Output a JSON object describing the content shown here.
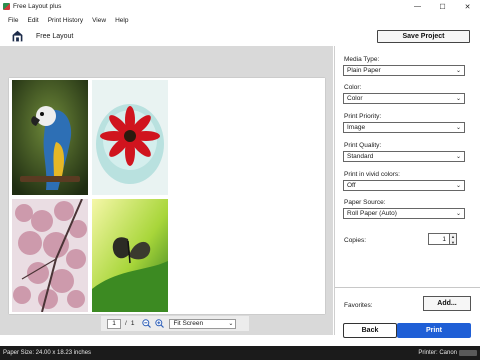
{
  "window": {
    "title": "Free Layout plus",
    "controls": {
      "minimize": "—",
      "maximize": "☐",
      "close": "✕"
    }
  },
  "menu": [
    "File",
    "Edit",
    "Print History",
    "View",
    "Help"
  ],
  "toolbar": {
    "page_label": "Free Layout",
    "save_project_label": "Save Project",
    "home_icon": "home-icon"
  },
  "preview": {
    "photos": [
      "parrot-photo",
      "gerbera-flower-photo",
      "cherry-blossom-photo",
      "butterfly-photo"
    ]
  },
  "navigation": {
    "current_page": "1",
    "separator": "/",
    "total_pages": "1",
    "zoom_view": "Fit Screen",
    "zoom_out_icon": "zoom-out-icon",
    "zoom_in_icon": "zoom-in-icon"
  },
  "settings": {
    "media_type": {
      "label": "Media Type:",
      "value": "Plain Paper"
    },
    "color": {
      "label": "Color:",
      "value": "Color"
    },
    "print_priority": {
      "label": "Print Priority:",
      "value": "Image"
    },
    "print_quality": {
      "label": "Print Quality:",
      "value": "Standard"
    },
    "vivid_colors": {
      "label": "Print in vivid colors:",
      "value": "Off"
    },
    "paper_source": {
      "label": "Paper Source:",
      "value": "Roll Paper (Auto)"
    },
    "copies": {
      "label": "Copies:",
      "value": "1"
    }
  },
  "favorites": {
    "label": "Favorites:",
    "add_label": "Add..."
  },
  "actions": {
    "back_label": "Back",
    "print_label": "Print"
  },
  "status": {
    "paper_size": "Paper Size: 24.00 x 18.23 inches",
    "printer": "Printer: Canon"
  },
  "colors": {
    "accent": "#1f5fd6",
    "preview_bg": "#d9d9d9",
    "statusbar_bg": "#1b1b1b"
  }
}
